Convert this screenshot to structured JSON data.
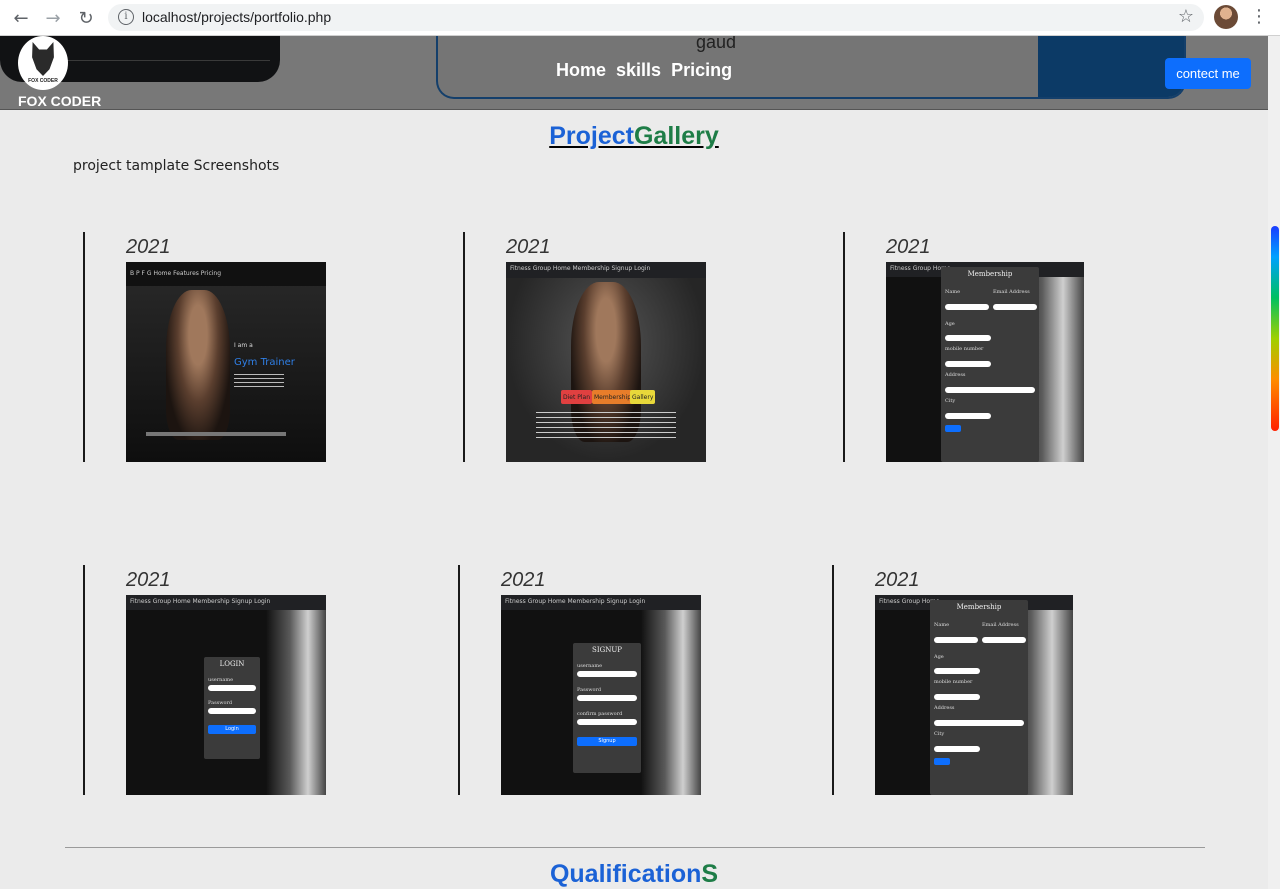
{
  "browser": {
    "url": "localhost/projects/portfolio.php"
  },
  "header": {
    "brand_name": "FOX CODER",
    "logo_tag": "FOX CODER",
    "top_text": "gaud",
    "nav": [
      "Home",
      "skills",
      "Pricing"
    ],
    "contact_label": "contect me",
    "accent_color": "#0d6efd",
    "panel_border_color": "#143f6b"
  },
  "gallery": {
    "title_part1": "Project",
    "title_part2": "Gallery",
    "subtitle": "project tamplate Screenshots",
    "items": [
      {
        "year": "2021",
        "topbar": "B P F G     Home  Features  Pricing",
        "caption1": "I am a",
        "caption2": "Gym Trainer"
      },
      {
        "year": "2021",
        "topbar": "Fitness Group   Home  Membership  Signup  Login",
        "btn1": "Diet Plan",
        "btn2": "Membership",
        "btn3": "Gallery"
      },
      {
        "year": "2021",
        "topbar": "Fitness Group   Home",
        "panel_title": "Membership",
        "l1": "Name",
        "l2": "Email Address",
        "l3": "Age",
        "l4": "mobile number",
        "l5": "Address",
        "l6": "City"
      },
      {
        "year": "2021",
        "topbar": "Fitness Group   Home  Membership  Signup  Login",
        "panel_title": "LOGIN",
        "l1": "username",
        "l2": "Password",
        "btn": "Login"
      },
      {
        "year": "2021",
        "topbar": "Fitness Group   Home  Membership  Signup  Login",
        "panel_title": "SIGNUP",
        "l1": "username",
        "l2": "Password",
        "l3": "confirm password",
        "btn": "Signup"
      },
      {
        "year": "2021",
        "topbar": "Fitness Group   Home",
        "panel_title": "Membership",
        "l1": "Name",
        "l2": "Email Address",
        "l3": "Age",
        "l4": "mobile number",
        "l5": "Address",
        "l6": "City"
      }
    ]
  },
  "qualifications": {
    "title_part1": "Qualification",
    "title_part2": "S"
  }
}
